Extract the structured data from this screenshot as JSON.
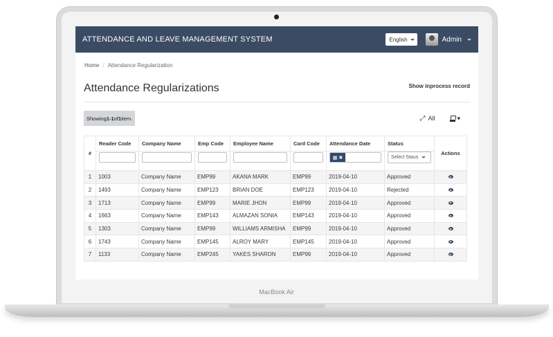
{
  "device": {
    "brand_label": "MacBook Air"
  },
  "header": {
    "title": "ATTENDANCE AND LEAVE MANAGEMENT SYSTEM",
    "language": "English",
    "user_name": "Admin"
  },
  "breadcrumb": {
    "home": "Home",
    "separator": "/",
    "current": "Attendance Regularization"
  },
  "page": {
    "title": "Attendance Regularizations",
    "inprocess_link": "Show inprocess record"
  },
  "toolbar": {
    "summary_prefix": "Showing ",
    "summary_range": "1-1",
    "summary_mid": " of ",
    "summary_total": "1",
    "summary_suffix": " item.",
    "toggle_all_label": "All",
    "export_caret": "▾"
  },
  "table": {
    "columns": {
      "hash": "#",
      "reader_code": "Reader Code",
      "company_name": "Company Name",
      "emp_code": "Emp Code",
      "employee_name": "Employee Name",
      "card_code": "Card Code",
      "attendance_date": "Attendance Date",
      "status": "Status",
      "actions": "Actions"
    },
    "filters": {
      "status_placeholder": "Select Staus",
      "date_addon": "▦ ✖"
    },
    "rows": [
      {
        "n": "1",
        "reader": "1003",
        "company": "Company Name",
        "emp": "EMP99",
        "name": "AKANA MARK",
        "card": "EMP99",
        "date": "2019-04-10",
        "status": "Approved"
      },
      {
        "n": "2",
        "reader": "1493",
        "company": "Company Name",
        "emp": "EMP123",
        "name": "BRIAN DOE",
        "card": "EMP123",
        "date": "2019-04-10",
        "status": "Rejected"
      },
      {
        "n": "3",
        "reader": "1713",
        "company": "Company Name",
        "emp": "EMP99",
        "name": "MARIE JHON",
        "card": "EMP99",
        "date": "2019-04-10",
        "status": "Approved"
      },
      {
        "n": "4",
        "reader": "1663",
        "company": "Company Name",
        "emp": "EMP143",
        "name": "ALMAZAN SONIA",
        "card": "EMP143",
        "date": "2019-04-10",
        "status": "Approved"
      },
      {
        "n": "5",
        "reader": "1303",
        "company": "Company Name",
        "emp": "EMP99",
        "name": "WILLIAMS ARMISHA",
        "card": "EMP99",
        "date": "2019-04-10",
        "status": "Approved"
      },
      {
        "n": "6",
        "reader": "1743",
        "company": "Company Name",
        "emp": "EMP145",
        "name": "ALROY MARY",
        "card": "EMP145",
        "date": "2019-04-10",
        "status": "Approved"
      },
      {
        "n": "7",
        "reader": "1133",
        "company": "Company Name",
        "emp": "EMP245",
        "name": "YAKES SHARON",
        "card": "EMP99",
        "date": "2019-04-10",
        "status": "Approved"
      }
    ]
  },
  "colors": {
    "navbar": "#3b4b64",
    "date_addon": "#2f4a6b",
    "summary_bg": "#d4d6d9"
  },
  "icons": {
    "expand": "expand-arrows-icon",
    "export": "export-icon",
    "view": "eye-icon",
    "calendar": "calendar-icon",
    "clear": "clear-icon"
  }
}
